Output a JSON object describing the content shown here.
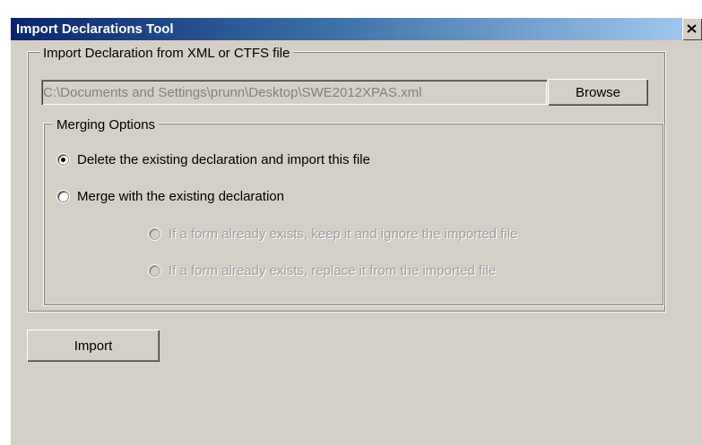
{
  "window": {
    "title": "Import Declarations Tool"
  },
  "import_group": {
    "legend": "Import Declaration from XML or CTFS file",
    "file_path": "C:\\Documents and Settings\\prunn\\Desktop\\SWE2012XPAS.xml",
    "browse_label": "Browse"
  },
  "merging_group": {
    "legend": "Merging Options",
    "options": [
      {
        "label": "Delete the existing declaration and import this file",
        "checked": true,
        "enabled": true
      },
      {
        "label": "Merge with the existing declaration",
        "checked": false,
        "enabled": true
      }
    ],
    "sub_options": [
      {
        "label": "If a form already exists, keep it and ignore the imported file",
        "checked": false,
        "enabled": false
      },
      {
        "label": "If a form already exists, replace it from the imported file",
        "checked": false,
        "enabled": false
      }
    ]
  },
  "import_label": "Import",
  "icons": {
    "close": "close-icon"
  }
}
